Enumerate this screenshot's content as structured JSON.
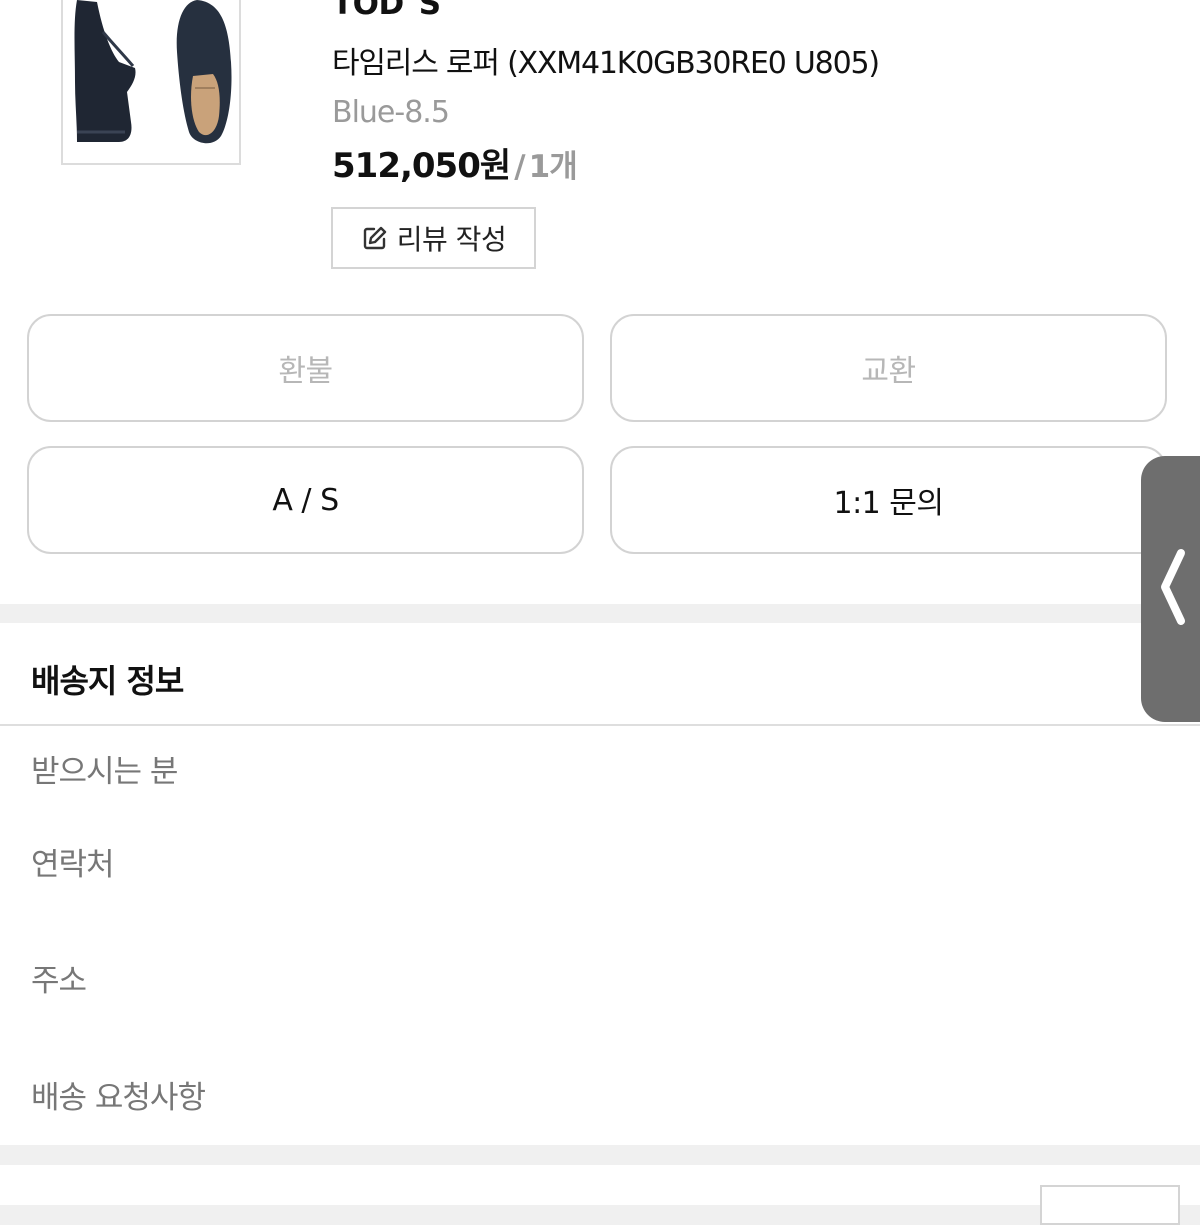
{
  "product": {
    "brand": "TOD`S",
    "name": "타임리스 로퍼 (XXM41K0GB30RE0 U805)",
    "option": "Blue-8.5",
    "price": "512,050원",
    "separator": "/",
    "quantity": "1개",
    "review_button_label": "리뷰 작성",
    "thumbnail_icon": "loafer-shoes-image"
  },
  "actions": {
    "refund": "환불",
    "exchange": "교환",
    "as": "A / S",
    "inquiry": "1:1 문의"
  },
  "shipping": {
    "title": "배송지 정보",
    "fields": [
      {
        "label": "받으시는 분",
        "value": ""
      },
      {
        "label": "연락처",
        "value": ""
      },
      {
        "label": "주소",
        "value": ""
      },
      {
        "label": "배송 요청사항",
        "value": ""
      }
    ]
  },
  "side_tab": {
    "icon": "chevron-left-icon"
  },
  "colors": {
    "page_bg": "#f0f0f0",
    "muted_text": "#9a9a9a",
    "disabled_text": "#b7b7b7",
    "side_tab_bg": "#6e6e6e",
    "border": "#d3d3d3"
  }
}
